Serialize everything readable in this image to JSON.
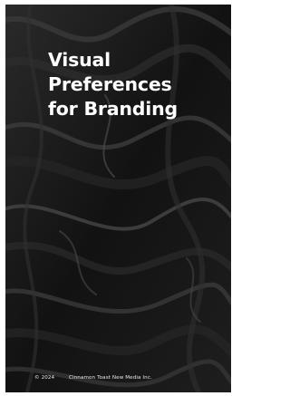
{
  "cover": {
    "title_lines": [
      "Visual",
      "Preferences",
      "for Branding"
    ],
    "copyright": "© 2024",
    "company": "Cinnamon Toast New Media Inc.",
    "background_color": "#0b0b0b",
    "text_color": "#ffffff"
  }
}
